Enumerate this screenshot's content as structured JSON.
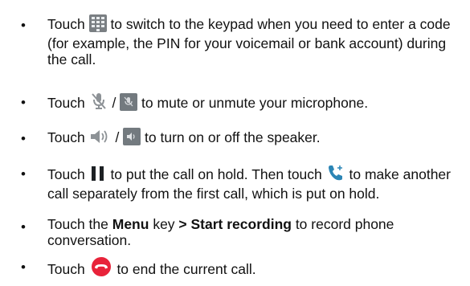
{
  "items": [
    {
      "a": "Touch ",
      "icon": "keypad-icon",
      "b": " to switch to the keypad when you need to enter a code (for example, the PIN for your voicemail or bank account) during the call."
    },
    {
      "a": "Touch ",
      "icon1": "mute-icon",
      "sep": " / ",
      "icon2": "unmute-icon",
      "b": " to mute or unmute your microphone."
    },
    {
      "a": "Touch ",
      "icon1": "speaker-icon",
      "sep": " / ",
      "icon2": "speaker-on-icon",
      "b": " to turn on or off the speaker."
    },
    {
      "a": "Touch ",
      "icon1": "hold-icon",
      "mid": " to put the call on hold. Then touch ",
      "icon2": "add-call-icon",
      "b": " to make another call separately from the first call, which is put on hold."
    },
    {
      "a": "Touch the ",
      "bold1": "Menu",
      "mid": " key ",
      "bold2": "> Start recording",
      "b": " to record phone conversation."
    },
    {
      "a": "Touch ",
      "icon": "end-call-icon",
      "b": " to end the current call."
    }
  ],
  "bullet": "•"
}
